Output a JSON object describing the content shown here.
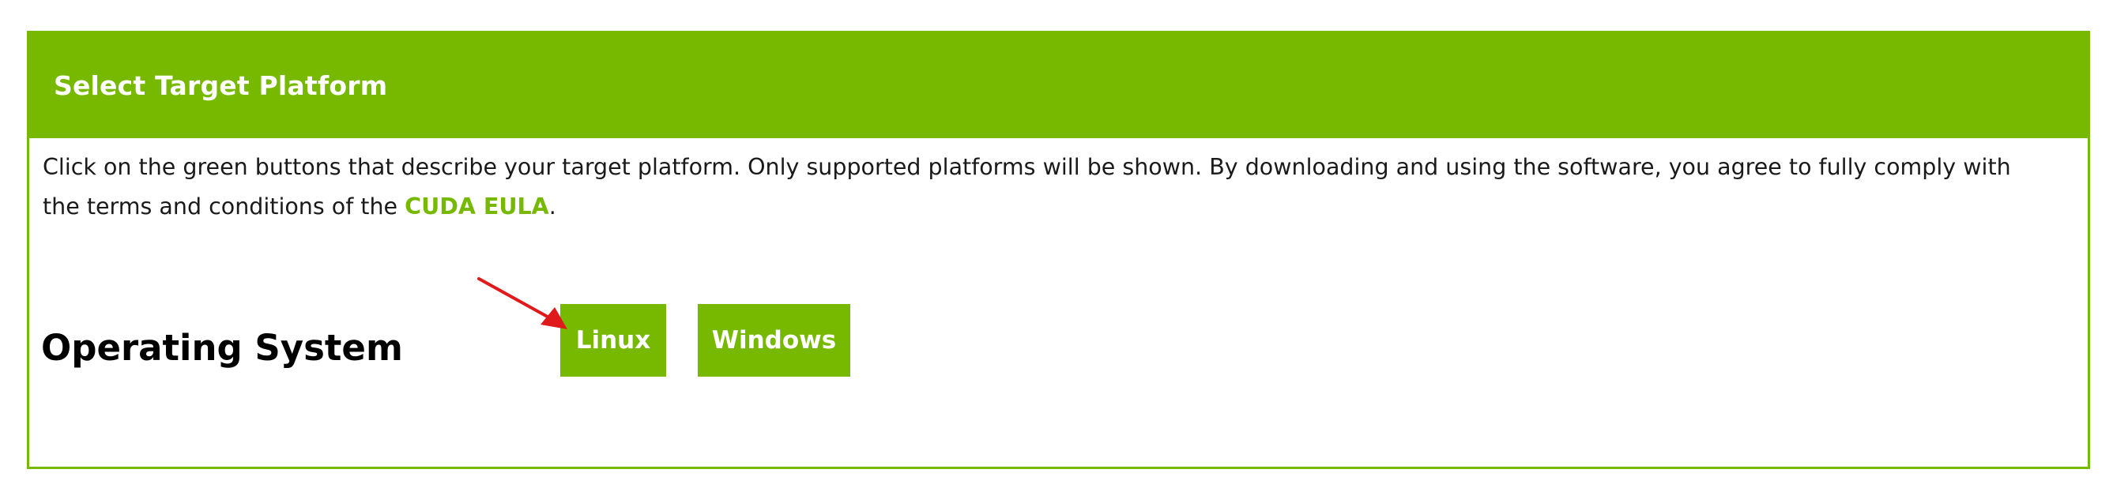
{
  "header": {
    "title": "Select Target Platform"
  },
  "description": {
    "text_before_link": "Click on the green buttons that describe your target platform. Only supported platforms will be shown. By downloading and using the software, you agree to fully comply with the terms and conditions of the ",
    "link_label": "CUDA EULA",
    "text_after_link": "."
  },
  "operating_system": {
    "label": "Operating System",
    "options": [
      {
        "label": "Linux"
      },
      {
        "label": "Windows"
      }
    ]
  },
  "colors": {
    "accent": "#76b900",
    "arrow": "#e0191b"
  }
}
